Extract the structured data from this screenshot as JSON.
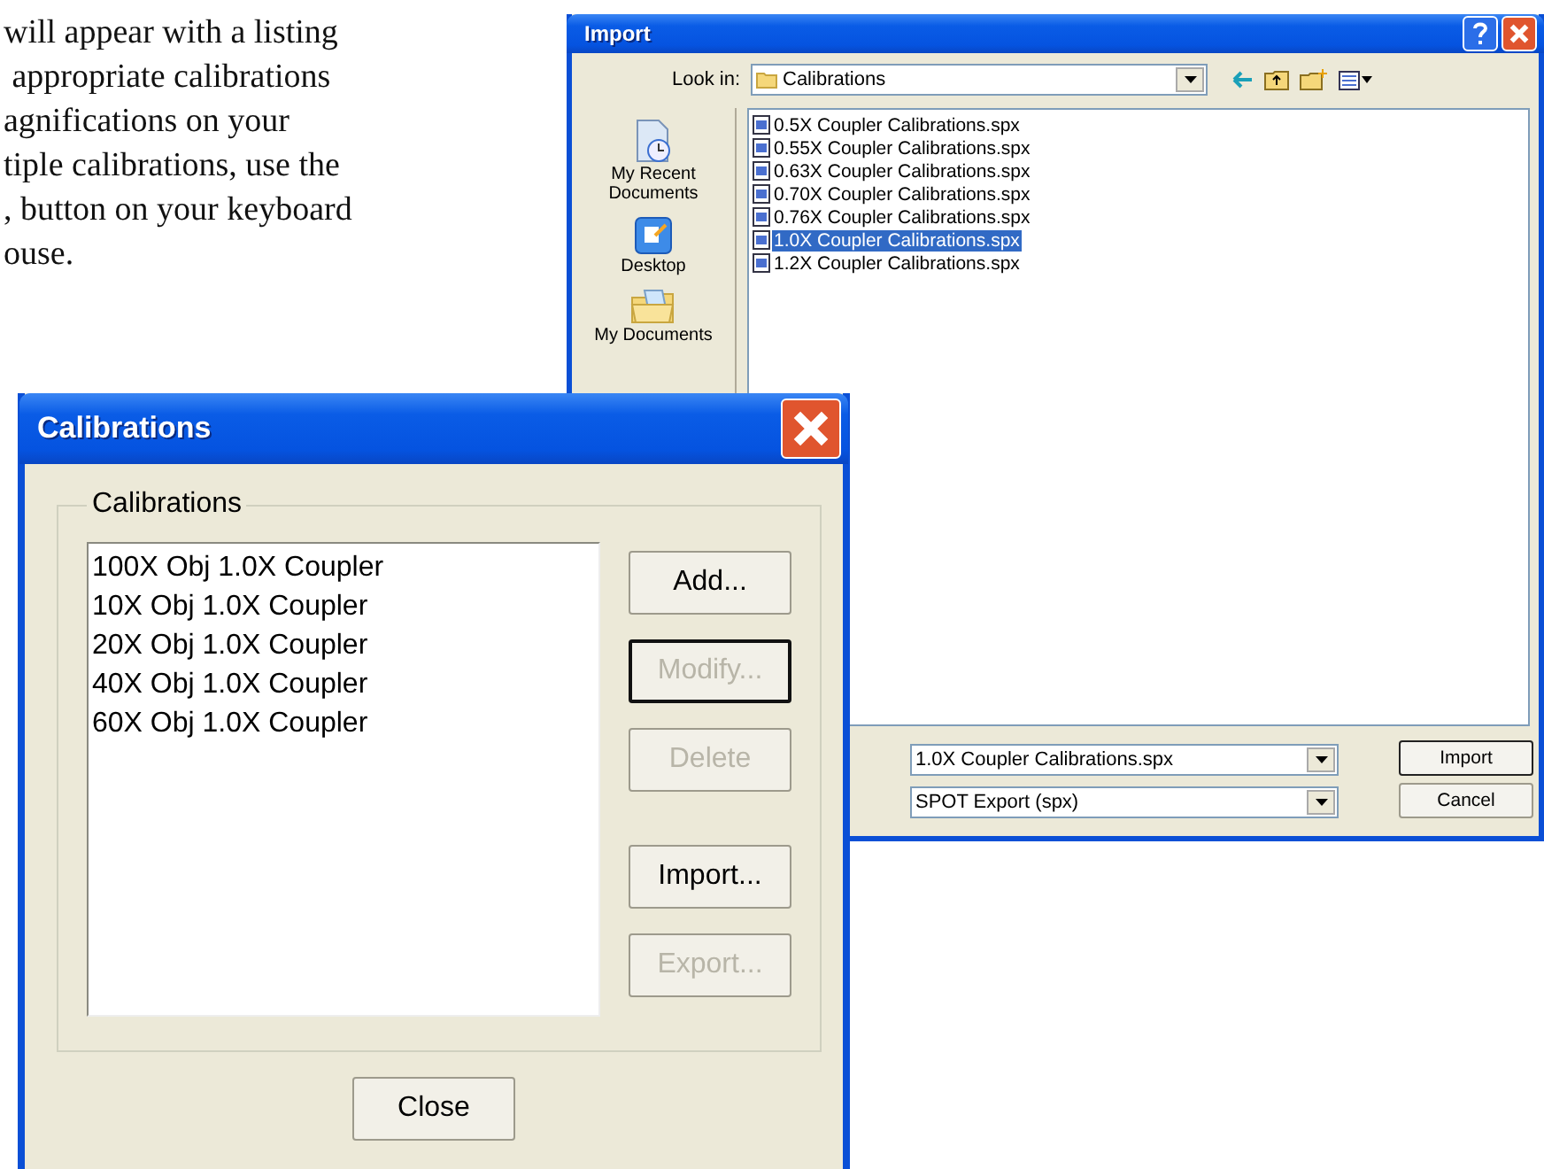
{
  "text_lines": [
    "will appear with a listing",
    " appropriate calibrations",
    "agnifications on your",
    "tiple calibrations, use the",
    ", button on your keyboard",
    "ouse."
  ],
  "import_dialog": {
    "title": "Import",
    "look_in_label": "Look in:",
    "look_in_value": "Calibrations",
    "places": [
      {
        "kind": "recent",
        "label": "My Recent Documents"
      },
      {
        "kind": "desktop",
        "label": "Desktop"
      },
      {
        "kind": "documents",
        "label": "My Documents"
      }
    ],
    "files": [
      {
        "name": "0.5X Coupler Calibrations.spx",
        "selected": false
      },
      {
        "name": "0.55X Coupler Calibrations.spx",
        "selected": false
      },
      {
        "name": "0.63X Coupler Calibrations.spx",
        "selected": false
      },
      {
        "name": "0.70X Coupler Calibrations.spx",
        "selected": false
      },
      {
        "name": "0.76X Coupler Calibrations.spx",
        "selected": false
      },
      {
        "name": "1.0X Coupler Calibrations.spx",
        "selected": true
      },
      {
        "name": "1.2X Coupler Calibrations.spx",
        "selected": false
      }
    ],
    "file_name": "1.0X Coupler Calibrations.spx",
    "file_type": "SPOT Export (spx)",
    "buttons": [
      {
        "label": "Import",
        "focused": true
      },
      {
        "label": "Cancel",
        "focused": false
      }
    ]
  },
  "calibrations_dialog": {
    "title": "Calibrations",
    "group_label": "Calibrations",
    "items": [
      "100X Obj 1.0X Coupler",
      "10X Obj 1.0X Coupler",
      "20X Obj 1.0X Coupler",
      "40X Obj 1.0X Coupler",
      "60X Obj 1.0X Coupler"
    ],
    "buttons": [
      {
        "label": "Add...",
        "disabled": false,
        "focused": false
      },
      {
        "label": "Modify...",
        "disabled": true,
        "focused": true
      },
      {
        "label": "Delete",
        "disabled": true,
        "focused": false
      },
      {
        "label": "Import...",
        "disabled": false,
        "focused": false
      },
      {
        "label": "Export...",
        "disabled": true,
        "focused": false
      }
    ],
    "close_button": "Close"
  }
}
